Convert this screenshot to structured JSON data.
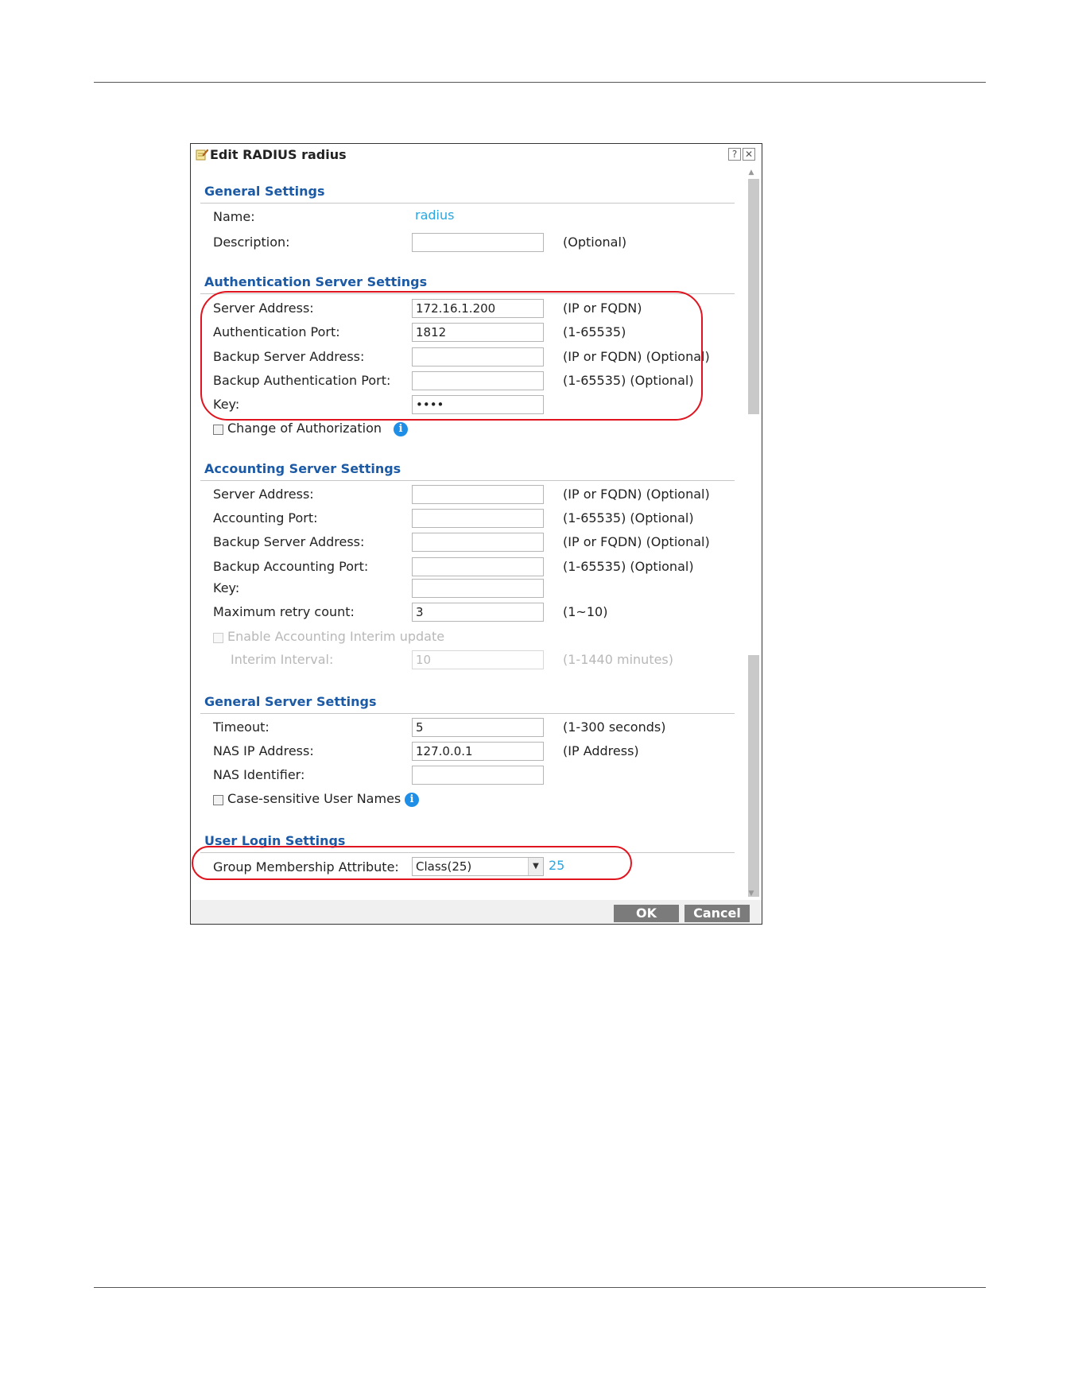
{
  "dialog": {
    "title": "Edit RADIUS radius",
    "help_label": "?",
    "close_label": "✕"
  },
  "general_settings": {
    "heading": "General Settings",
    "name_label": "Name:",
    "name_value": "radius",
    "description_label": "Description:",
    "description_value": "",
    "description_hint": "(Optional)"
  },
  "auth_server": {
    "heading": "Authentication Server Settings",
    "server_address_label": "Server Address:",
    "server_address_value": "172.16.1.200",
    "server_address_hint": "(IP or FQDN)",
    "auth_port_label": "Authentication Port:",
    "auth_port_value": "1812",
    "auth_port_hint": "(1-65535)",
    "backup_server_label": "Backup Server Address:",
    "backup_server_value": "",
    "backup_server_hint": "(IP or FQDN) (Optional)",
    "backup_port_label": "Backup Authentication Port:",
    "backup_port_value": "",
    "backup_port_hint": "(1-65535) (Optional)",
    "key_label": "Key:",
    "key_value": "••••",
    "coa_label": "Change of Authorization",
    "coa_checked": false
  },
  "acct_server": {
    "heading": "Accounting Server Settings",
    "server_address_label": "Server Address:",
    "server_address_value": "",
    "server_address_hint": "(IP or FQDN) (Optional)",
    "acct_port_label": "Accounting Port:",
    "acct_port_value": "",
    "acct_port_hint": "(1-65535) (Optional)",
    "backup_server_label": "Backup Server Address:",
    "backup_server_value": "",
    "backup_server_hint": "(IP or FQDN) (Optional)",
    "backup_port_label": "Backup Accounting Port:",
    "backup_port_value": "",
    "backup_port_hint": "(1-65535) (Optional)",
    "key_label": "Key:",
    "key_value": "",
    "retry_label": "Maximum retry count:",
    "retry_value": "3",
    "retry_hint": "(1~10)",
    "interim_update_label": "Enable Accounting Interim update",
    "interim_interval_label": "Interim Interval:",
    "interim_interval_value": "10",
    "interim_interval_hint": "(1-1440 minutes)"
  },
  "general_server": {
    "heading": "General Server Settings",
    "timeout_label": "Timeout:",
    "timeout_value": "5",
    "timeout_hint": "(1-300 seconds)",
    "nas_ip_label": "NAS IP Address:",
    "nas_ip_value": "127.0.0.1",
    "nas_ip_hint": "(IP Address)",
    "nas_id_label": "NAS Identifier:",
    "nas_id_value": "",
    "case_sensitive_label": "Case-sensitive User Names",
    "case_sensitive_checked": false
  },
  "user_login": {
    "heading": "User Login Settings",
    "group_attr_label": "Group Membership Attribute:",
    "group_attr_selected": "Class(25)",
    "group_attr_value": "25"
  },
  "footer": {
    "ok_label": "OK",
    "cancel_label": "Cancel"
  },
  "colors": {
    "section_heading": "#1c5aa6",
    "highlight_oval": "#e0141e",
    "link_value": "#2aa7e0",
    "button_bg": "#7b7b7b"
  }
}
